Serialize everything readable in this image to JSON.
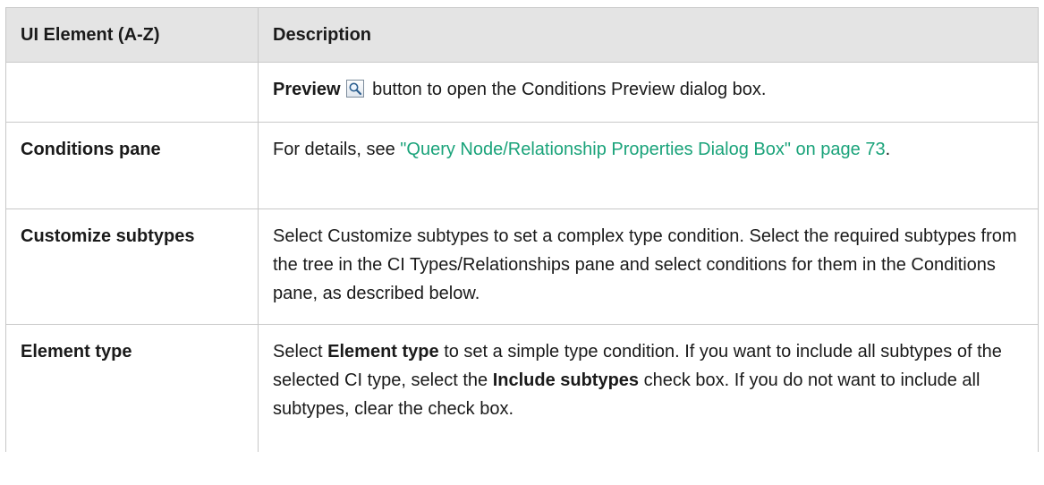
{
  "table": {
    "headers": {
      "col1": "UI Element (A-Z)",
      "col2": "Description"
    },
    "rows": {
      "preview": {
        "name": "",
        "bold_label": "Preview",
        "icon": "magnifier-icon",
        "text": " button to open the Conditions Preview dialog box."
      },
      "conditions": {
        "name": "Conditions pane",
        "prefix": "For details, see ",
        "link": "\"Query Node/Relationship Properties Dialog Box\" on page 73",
        "suffix": "."
      },
      "customize": {
        "name": "Customize subtypes",
        "text": "Select Customize subtypes to set a complex type condition. Select the required subtypes from the tree in the CI Types/Relationships pane and select conditions for them in the Conditions pane, as described below."
      },
      "element": {
        "name": "Element type",
        "t1": "Select ",
        "b1": "Element type",
        "t2": " to set a simple type condition. If you want to include all subtypes of the selected CI type, select the ",
        "b2": "Include subtypes",
        "t3": " check box. If you do not want to include all subtypes, clear the check box."
      }
    }
  },
  "colors": {
    "header_bg": "#e4e4e4",
    "border": "#c8c8c8",
    "link": "#1aa37a"
  }
}
